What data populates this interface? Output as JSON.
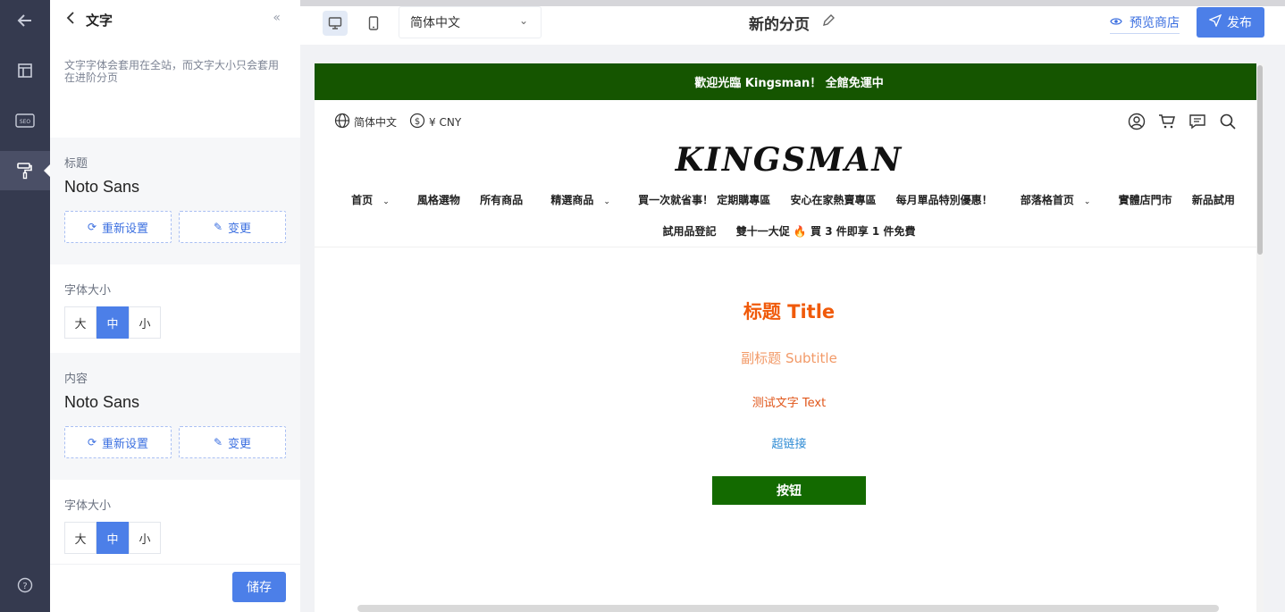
{
  "rail": {
    "items": [
      {
        "icon": "arrow-left-icon"
      },
      {
        "icon": "layout-icon"
      },
      {
        "icon": "seo-icon",
        "text": "SEO"
      },
      {
        "icon": "paint-roller-icon"
      },
      {
        "icon": "help-icon"
      }
    ]
  },
  "panel": {
    "title": "文字",
    "collapse": "«",
    "description": "文字字体会套用在全站，而文字大小只会套用在进阶分页",
    "heading": {
      "label": "标题",
      "font": "Noto Sans",
      "reset": "重新设置",
      "change": "变更",
      "size_label": "字体大小"
    },
    "content": {
      "label": "内容",
      "font": "Noto Sans",
      "reset": "重新设置",
      "change": "变更",
      "size_label": "字体大小"
    },
    "sizes": [
      "大",
      "中",
      "小"
    ],
    "selected_size": "中",
    "save": "储存"
  },
  "toolbar": {
    "language": "简体中文",
    "page_title": "新的分页",
    "preview": "预览商店",
    "publish": "发布",
    "accent": "#4c7fe8"
  },
  "store": {
    "announcement": "歡迎光臨 Kingsman！ 全館免運中",
    "language": "简体中文",
    "currency": "¥ CNY",
    "logo": "KINGSMAN",
    "nav": [
      "首页",
      "風格選物",
      "所有商品",
      "精選商品",
      "買一次就省事！ 定期購專區",
      "安心在家熱賣專區",
      "每月單品特別優惠！",
      "部落格首页",
      "實體店門市",
      "新品試用",
      "試用品登記",
      "雙十一大促 🔥 買 3 件即享 1 件免費"
    ],
    "caret": "⌄",
    "title": "标题 Title",
    "subtitle": "副标题 Subtitle",
    "text": "测试文字 Text",
    "link": "超链接",
    "button": "按钮",
    "colors": {
      "announce_bg": "#155500",
      "title": "#f05a0a",
      "subtitle": "#f29a68",
      "text": "#e0561a",
      "link": "#2e8bd4",
      "button_bg": "#136a00"
    }
  }
}
